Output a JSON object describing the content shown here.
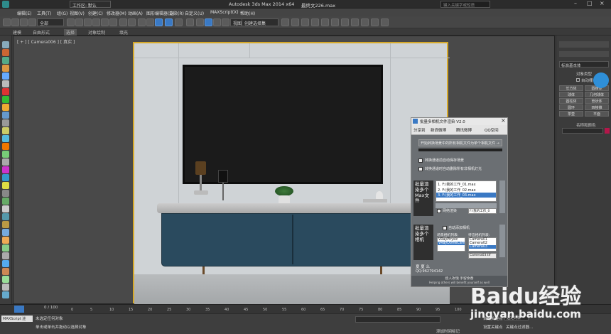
{
  "title_bar": {
    "workspace": "工作区: 默认",
    "app_title": "Autodesk 3ds Max  2014 x64",
    "file_name": "最终文226.max",
    "search_placeholder": "键入关键字或短语"
  },
  "menu": [
    "编辑(E)",
    "工具(T)",
    "组(G)",
    "视图(V)",
    "创建(C)",
    "修改器(M)",
    "动画(A)",
    "图形编辑器(D)",
    "渲染(R)",
    "自定义(U)",
    "MAXScript(X)",
    "帮助(H)"
  ],
  "toolbar": {
    "selection_filter": "全部",
    "view_dropdown": "视图",
    "selection_set": "创建选择集"
  },
  "ribbon_tabs": [
    "建模",
    "自由形式",
    "选择",
    "对象绘制",
    "填充"
  ],
  "viewport": {
    "label": "[ + ] [ Camera006 ] [ 真实 ]"
  },
  "plugin": {
    "title": "批量多相机文件渲染 V2.0",
    "tabs": [
      "分享到",
      "新浪微博",
      "腾讯微博",
      "QQ空间"
    ],
    "top_button": "开始转换场景中的所有相机文件为单个相机文件 →",
    "option1": "转换通道前自动保存场景",
    "option2": "转换通道时自动删除所有非相机灯光",
    "side_label_1": "批量渲染多个Max文件",
    "files": [
      "1. F:\\我的工作_01.max",
      "2. F:\\我的工作_02.max",
      "3. F:\\我的工作_03.max"
    ],
    "path_field": "F:\\我的工作_0",
    "net_render": "网络渲染",
    "side_label_2": "批量渲染多个相机",
    "auto_add_camera": "自动添加相机",
    "scene_cameras_header": "场景相机列表:",
    "render_cameras_header": "待渲相机列表:",
    "scene_cameras": [
      "VRayPhysic",
      "VRayDomeCamera"
    ],
    "render_cameras": [
      "Camera01",
      "Camera02",
      "Camera03"
    ],
    "output_file": "Camera03.tif",
    "author": "夏 夏 么",
    "qq": "QQ:962794142",
    "footer_cn": "授人玫瑰 手留余香",
    "footer_en": "Helping others will benefit yourself as well"
  },
  "right_panel": {
    "dropdown": "标准基本体",
    "section": "对象类型",
    "autogrid": "自动栅格",
    "buttons": [
      "长方体",
      "圆锥体",
      "球体",
      "几何球体",
      "圆柱体",
      "管状体",
      "圆环",
      "四棱锥",
      "茶壶",
      "平面"
    ],
    "name_color": "名称和颜色"
  },
  "timeline": {
    "frame": "0 / 100",
    "ticks": [
      "0",
      "5",
      "10",
      "15",
      "20",
      "25",
      "30",
      "35",
      "40",
      "45",
      "50",
      "55",
      "60",
      "65",
      "70",
      "75",
      "80",
      "85",
      "90",
      "95",
      "100"
    ]
  },
  "status": {
    "message1": "未选定任何对象",
    "message2": "单击或单击并拖动以选择对象",
    "script_label": "MAXScript 迷",
    "auto_key": "自动关键点",
    "selected_obj": "选定对象",
    "set_key": "设置关键点",
    "key_filter": "关键点过滤器...",
    "add_time_tag": "添加时间标记"
  },
  "watermark": {
    "brand": "Baidu经验",
    "url": "jingyan.baidu.com"
  },
  "colors": {
    "accent": "#3a79c4",
    "frame": "#d6a92a",
    "cabinet": "#2a4a5e"
  }
}
